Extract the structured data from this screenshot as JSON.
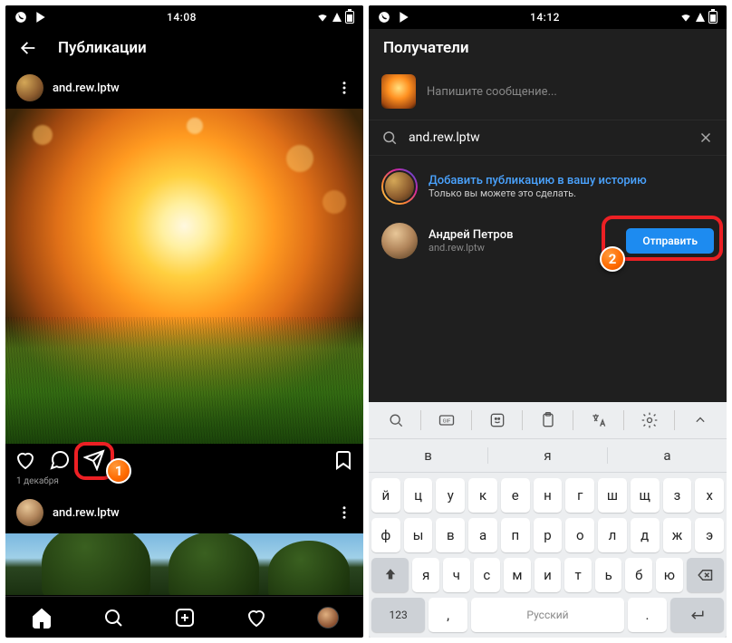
{
  "status": {
    "time_left": "14:08",
    "time_right": "14:12"
  },
  "left": {
    "header_title": "Публикации",
    "post1_user": "and.rew.lptw",
    "post_date": "1 декабря",
    "post2_user": "and.rew.lptw"
  },
  "right": {
    "header_title": "Получатели",
    "message_placeholder": "Напишите сообщение...",
    "search_value": "and.rew.lptw",
    "story_title": "Добавить публикацию в вашу историю",
    "story_sub": "Только вы можете это сделать.",
    "user_name": "Андрей Петров",
    "user_sub": "and.rew.lptw",
    "send_label": "Отправить"
  },
  "badges": {
    "one": "1",
    "two": "2"
  },
  "keyboard": {
    "suggestions": [
      "в",
      "я",
      "а"
    ],
    "row1": [
      "й",
      "ц",
      "у",
      "к",
      "е",
      "н",
      "г",
      "ш",
      "щ",
      "з",
      "х"
    ],
    "row2": [
      "ф",
      "ы",
      "в",
      "а",
      "п",
      "р",
      "о",
      "л",
      "д",
      "ж",
      "э"
    ],
    "row3": [
      "я",
      "ч",
      "с",
      "м",
      "и",
      "т",
      "ь",
      "б",
      "ю"
    ],
    "numkey": "123",
    "commakey": ",",
    "spacekey": "Русский",
    "dotkey": "."
  }
}
